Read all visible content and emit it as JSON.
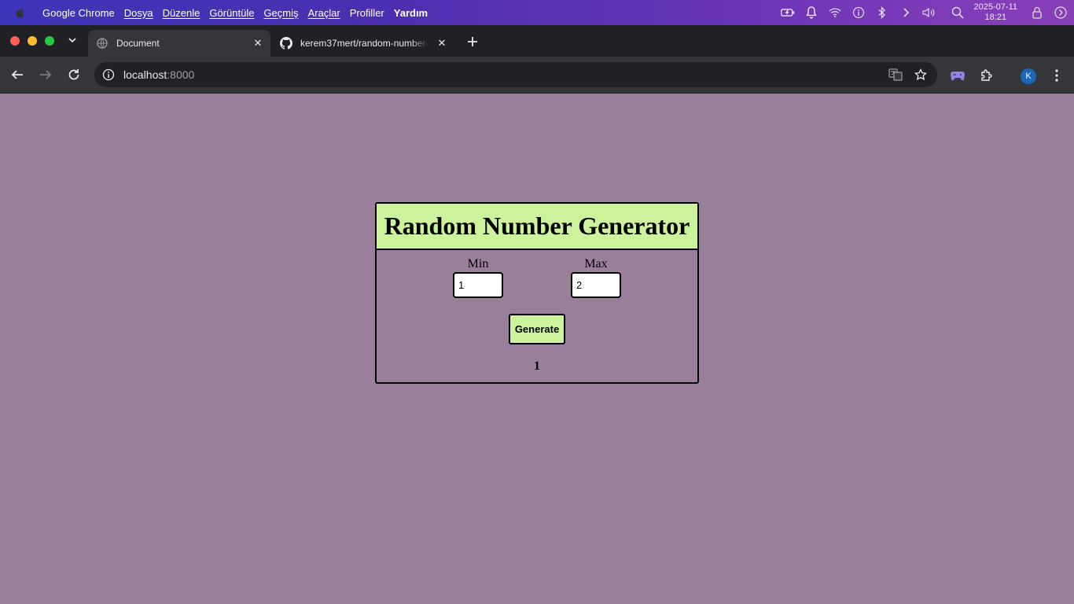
{
  "menubar": {
    "app_name": "Google Chrome",
    "items": [
      "Dosya",
      "Düzenle",
      "Görüntüle",
      "Geçmiş",
      "Araçlar",
      "Profiller",
      "Yardım"
    ],
    "clock_date": "2025-07-11",
    "clock_time": "18:21"
  },
  "tabs": [
    {
      "title": "Document",
      "active": true
    },
    {
      "title": "kerem37mert/random-number-generator",
      "active": false
    }
  ],
  "toolbar": {
    "url_host": "localhost",
    "url_port": ":8000",
    "avatar_letter": "K"
  },
  "app": {
    "title": "Random Number Generator",
    "min_label": "Min",
    "max_label": "Max",
    "min_value": "1",
    "max_value": "2",
    "generate_label": "Generate",
    "result": "1"
  },
  "colors": {
    "page_background": "#9a7f9a",
    "accent_green": "#ccf29b"
  }
}
